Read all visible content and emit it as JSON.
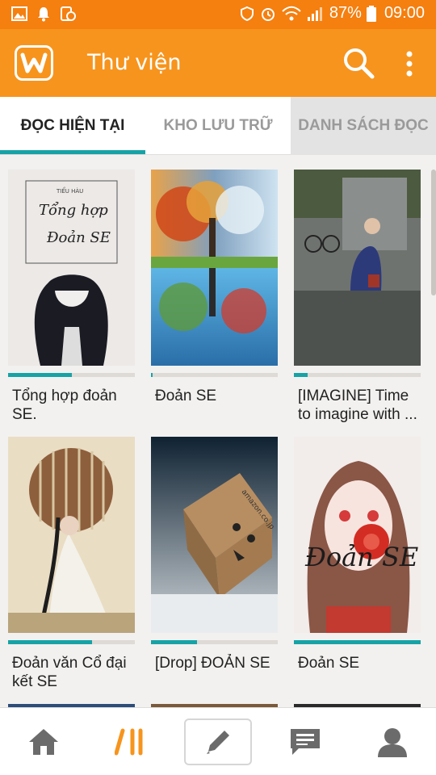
{
  "status_bar": {
    "battery": "87%",
    "time": "09:00"
  },
  "app_bar": {
    "title": "Thư viện"
  },
  "tabs": [
    {
      "label": "ĐỌC HIỆN TẠI",
      "active": true
    },
    {
      "label": "KHO LƯU TRỮ",
      "active": false
    },
    {
      "label": "DANH SÁCH ĐỌC",
      "active": false
    }
  ],
  "books": [
    {
      "title": "Tổng hợp đoản SE.",
      "progress": 0.5,
      "cover_text": [
        "TIỂU HÀU",
        "Tổng hợp",
        "Đoản SE"
      ]
    },
    {
      "title": "Đoản SE",
      "progress": 0.01,
      "cover_text": []
    },
    {
      "title": "[IMAGINE] Time to imagine with ...",
      "progress": 0.11,
      "cover_text": []
    },
    {
      "title": "Đoản văn Cổ đại kết SE",
      "progress": 0.66,
      "cover_text": []
    },
    {
      "title": "[Drop] ĐOẢN SE",
      "progress": 0.36,
      "cover_text": [
        "amazon.co.jp"
      ]
    },
    {
      "title": "Đoản SE",
      "progress": 1.0,
      "cover_text": [
        "Đoản SE"
      ]
    }
  ],
  "bottom_nav": {
    "items": [
      "home-icon",
      "library-icon",
      "write-icon",
      "messages-icon",
      "profile-icon"
    ]
  },
  "colors": {
    "app_bar": "#f7941d",
    "status_bar": "#f57f0f",
    "accent": "#17a3a6",
    "library_active": "#f7941d"
  }
}
